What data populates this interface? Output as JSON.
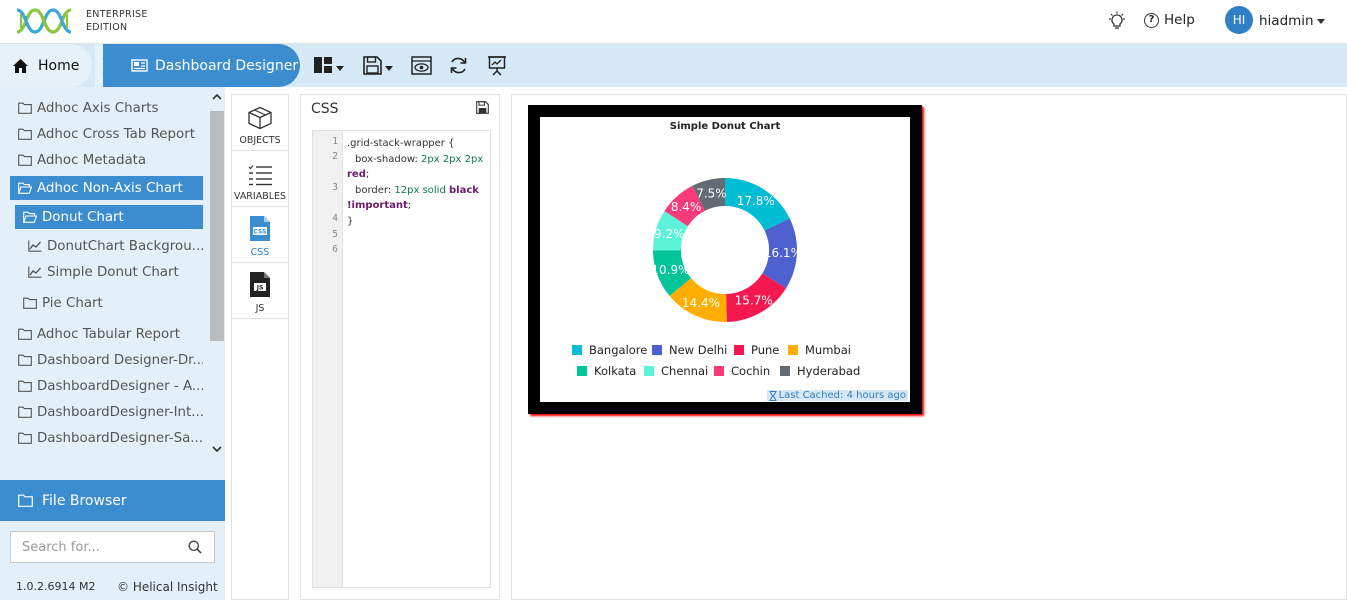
{
  "header": {
    "edition_line1": "ENTERPRISE",
    "edition_line2": "EDITION",
    "help_label": "Help",
    "avatar_initials": "HI",
    "username": "hiadmin"
  },
  "nav": {
    "home_label": "Home",
    "current_label": "Dashboard Designer"
  },
  "sidebar": {
    "items": [
      {
        "label": "Adhoc Axis Charts",
        "icon": "folder-icon",
        "selected": false
      },
      {
        "label": "Adhoc Cross Tab Report",
        "icon": "folder-icon",
        "selected": false
      },
      {
        "label": "Adhoc Metadata",
        "icon": "folder-icon",
        "selected": false
      },
      {
        "label": "Adhoc Non-Axis Chart",
        "icon": "folder-open-icon",
        "selected": true
      },
      {
        "label": "Donut Chart",
        "icon": "folder-open-icon",
        "selected": true
      },
      {
        "label": "DonutChart Backgrou...",
        "icon": "chart-line-icon",
        "selected": false
      },
      {
        "label": "Simple Donut Chart",
        "icon": "chart-line-icon",
        "selected": false
      },
      {
        "label": "Pie Chart",
        "icon": "folder-icon",
        "selected": false
      },
      {
        "label": "Adhoc Tabular Report",
        "icon": "folder-icon",
        "selected": false
      },
      {
        "label": "Dashboard Designer-Dr...",
        "icon": "folder-icon",
        "selected": false
      },
      {
        "label": "DashboardDesigner - A...",
        "icon": "folder-icon",
        "selected": false
      },
      {
        "label": "DashboardDesigner-Int...",
        "icon": "folder-icon",
        "selected": false
      },
      {
        "label": "DashboardDesigner-Sa...",
        "icon": "folder-icon",
        "selected": false
      }
    ],
    "file_browser_label": "File Browser",
    "search_placeholder": "Search for...",
    "version": "1.0.2.6914 M2",
    "copyright": "© Helical Insight"
  },
  "toolstrip": {
    "items": [
      {
        "label": "OBJECTS",
        "icon": "cube-icon",
        "active": false
      },
      {
        "label": "VARIABLES",
        "icon": "list-icon",
        "active": false
      },
      {
        "label": "CSS",
        "icon": "css-file-icon",
        "active": true
      },
      {
        "label": "JS",
        "icon": "js-file-icon",
        "active": false
      }
    ]
  },
  "editor": {
    "title": "CSS",
    "line_numbers": [
      "1",
      "2",
      "3",
      "4",
      "5",
      "6"
    ],
    "code": {
      "l1": ".grid-stack-wrapper {",
      "l2_prop": "box-shadow:",
      "l2_val": "2px 2px 2px",
      "l2_kw": "red",
      "l2_end": ";",
      "l3_prop": "border:",
      "l3_val": "12px solid",
      "l3_kw": "black",
      "l3_imp": "!important",
      "l3_end": ";",
      "l4": "}"
    }
  },
  "colors": {
    "accent": "#3b8dd0",
    "nav_bg": "#d6e9f6",
    "sidebar_bg": "#e4f0f9",
    "card_border": "#000000",
    "card_shadow": "#ff0000"
  },
  "chart_data": {
    "type": "pie",
    "title": "Simple Donut Chart",
    "series": [
      {
        "name": "Bangalore",
        "value": 17.8,
        "label": "17.8%",
        "color": "#00bcd4"
      },
      {
        "name": "New Delhi",
        "value": 16.1,
        "label": "16.1%",
        "color": "#4e5fd0"
      },
      {
        "name": "Pune",
        "value": 15.7,
        "label": "15.7%",
        "color": "#f5174f"
      },
      {
        "name": "Mumbai",
        "value": 14.4,
        "label": "14.4%",
        "color": "#ffae00"
      },
      {
        "name": "Kolkata",
        "value": 10.9,
        "label": "10.9%",
        "color": "#00c49a"
      },
      {
        "name": "Chennai",
        "value": 9.2,
        "label": "9.2%",
        "color": "#5cf4d8"
      },
      {
        "name": "Cochin",
        "value": 8.4,
        "label": "8.4%",
        "color": "#f73a7a"
      },
      {
        "name": "Hyderabad",
        "value": 7.5,
        "label": "7.5%",
        "color": "#636c75"
      }
    ],
    "legend_position": "bottom",
    "cache_text": "Last Cached: 4 hours ago"
  }
}
